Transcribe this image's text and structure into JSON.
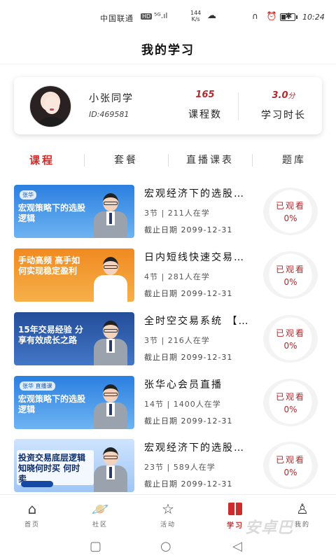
{
  "status_bar": {
    "carrier": "中国联通",
    "hd": "HD",
    "signal": "⁵ᴳ.ıl",
    "net_speed_value": "144",
    "net_speed_unit": "K/s",
    "icons": "∩ ⏰ ✱",
    "time": "10:24"
  },
  "header": {
    "title": "我的学习"
  },
  "profile": {
    "name": "小张同学",
    "id": "ID:469581",
    "course_count": "165",
    "course_count_label": "课程数",
    "study_hours": "3.0",
    "study_hours_unit": "分",
    "study_hours_label": "学习时长"
  },
  "tabs": [
    {
      "label": "课程"
    },
    {
      "label": "套餐"
    },
    {
      "label": "直播课表"
    },
    {
      "label": "题库"
    }
  ],
  "courses": [
    {
      "title": "宏观经济下的选股…",
      "meta": "3节 | 211人在学",
      "deadline": "截止日期 2099-12-31",
      "progress_label": "已观看",
      "progress": "0%",
      "thumb_text": "宏观策略下的选股逻辑",
      "thumb_tag": "张华"
    },
    {
      "title": "日内短线快速交易…",
      "meta": "4节 | 281人在学",
      "deadline": "截止日期 2099-12-31",
      "progress_label": "已观看",
      "progress": "0%",
      "thumb_text": "手动高频 高手如何实现稳定盈利",
      "thumb_tag": ""
    },
    {
      "title": "全时空交易系统 【…",
      "meta": "3节 | 216人在学",
      "deadline": "截止日期 2099-12-31",
      "progress_label": "已观看",
      "progress": "0%",
      "thumb_text": "15年交易经验 分享有效成长之路",
      "thumb_tag": ""
    },
    {
      "title": "张华心会员直播",
      "meta": "14节 | 1400人在学",
      "deadline": "截止日期 2099-12-31",
      "progress_label": "已观看",
      "progress": "0%",
      "thumb_text": "宏观策略下的选股逻辑",
      "thumb_tag": "张华 直播课"
    },
    {
      "title": "宏观经济下的选股…",
      "meta": "23节 | 589人在学",
      "deadline": "截止日期 2099-12-31",
      "progress_label": "已观看",
      "progress": "0%",
      "thumb_text": "投资交易底层逻辑 知晓何时买 何时卖",
      "thumb_tag": ""
    }
  ],
  "bottom_nav": [
    {
      "label": "首页",
      "icon": "home-icon"
    },
    {
      "label": "社区",
      "icon": "planet-icon"
    },
    {
      "label": "活动",
      "icon": "star-icon"
    },
    {
      "label": "学习",
      "icon": "book-icon"
    },
    {
      "label": "我的",
      "icon": "user-icon"
    }
  ],
  "watermark": "安卓巴",
  "colors": {
    "accent": "#d02a2a",
    "progress_text": "#b5282e"
  }
}
